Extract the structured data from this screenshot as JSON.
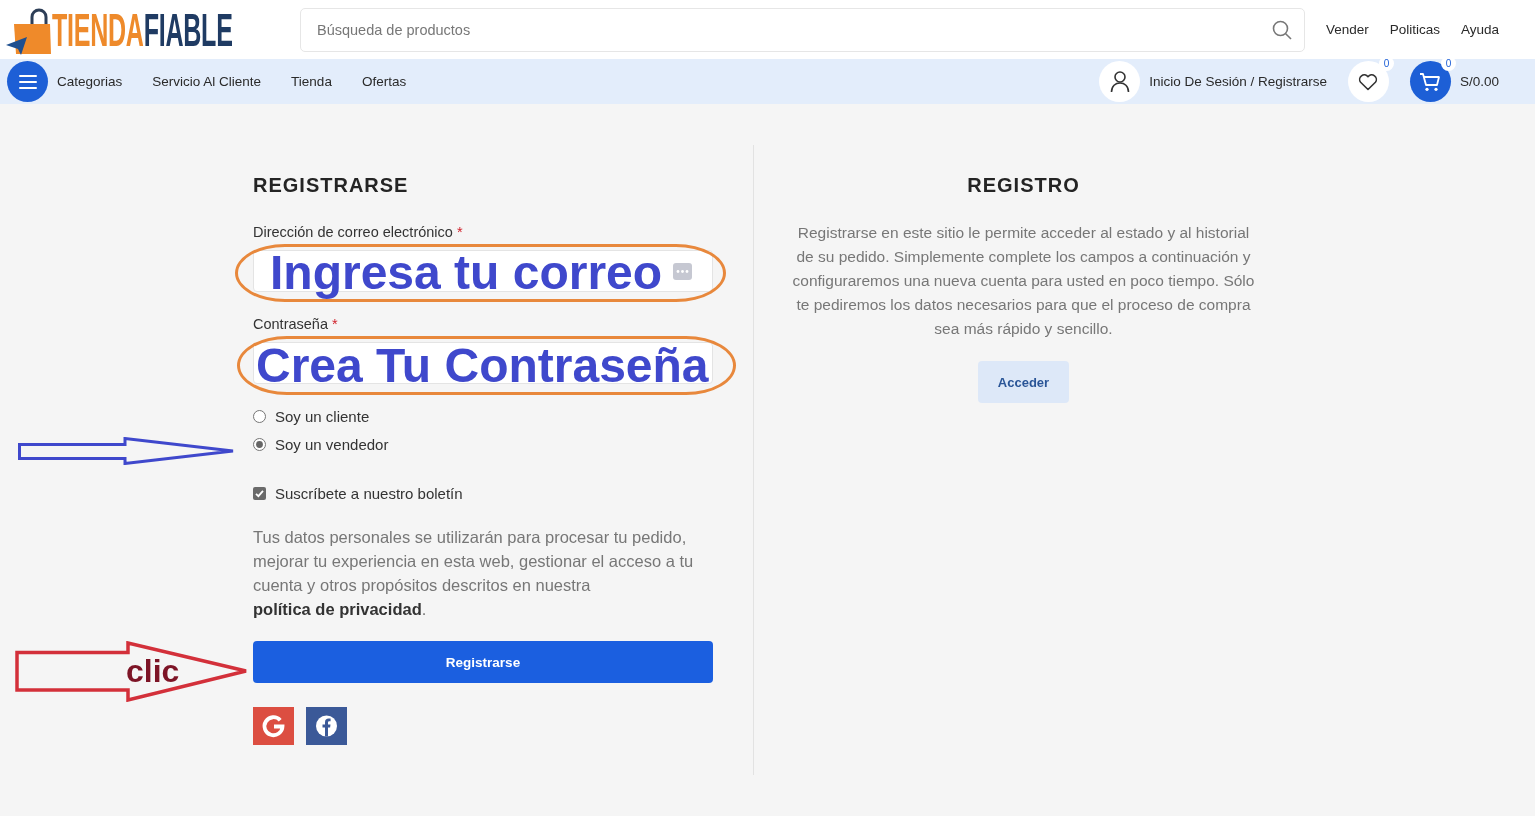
{
  "header": {
    "logo": {
      "first_part": "TIENDA",
      "second_part": "FIABLE"
    },
    "search": {
      "placeholder": "Búsqueda de productos"
    },
    "links": [
      "Vender",
      "Politicas",
      "Ayuda"
    ]
  },
  "navbar": {
    "items": [
      "Categorias",
      "Servicio Al Cliente",
      "Tienda",
      "Ofertas"
    ],
    "account": "Inicio De Sesión / Registrarse",
    "wishlist_count": "0",
    "cart_count": "0",
    "cart_total": "S/0.00"
  },
  "register": {
    "title": "REGISTRARSE",
    "fields": [
      {
        "kind": "email",
        "label": "Dirección de correo electrónico",
        "required_mark": "*",
        "callout": "Ingresa tu correo"
      },
      {
        "kind": "password",
        "label": "Contraseña",
        "required_mark": "*",
        "callout": "Crea Tu Contraseña"
      }
    ],
    "roles": [
      {
        "label": "Soy un cliente",
        "selected": false,
        "pointer_arrow": false
      },
      {
        "label": "Soy un vendedor",
        "selected": true,
        "pointer_arrow": true
      }
    ],
    "newsletter": {
      "label": "Suscríbete a nuestro boletín",
      "checked": true
    },
    "privacy": {
      "text": "Tus datos personales se utilizarán para procesar tu pedido, mejorar tu experiencia en esta web, gestionar el acceso a tu cuenta y otros propósitos descritos en nuestra ",
      "link": "política de privacidad",
      "end": "."
    },
    "submit": {
      "label": "Registrarse",
      "arrow_note": "clic"
    }
  },
  "info": {
    "title": "REGISTRO",
    "text": "Registrarse en este sitio le permite acceder al estado y al historial de su pedido. Simplemente complete los campos a continuación y configuraremos una nueva cuenta para usted en poco tiempo. Sólo te pediremos los datos necesarios para que el proceso de compra sea más rápido y sencillo.",
    "button": "Acceder"
  }
}
